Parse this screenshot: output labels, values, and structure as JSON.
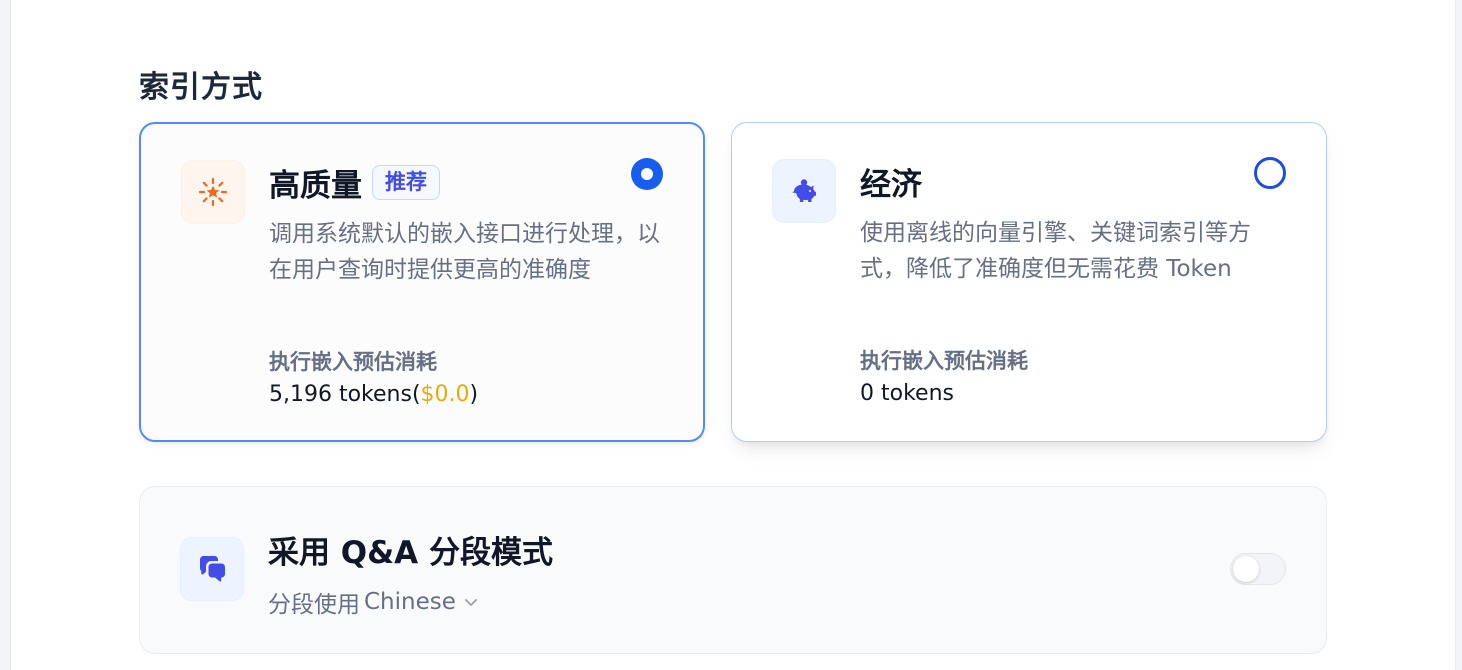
{
  "index_method": {
    "title": "索引方式",
    "options": [
      {
        "title": "高质量",
        "badge": "推荐",
        "description": "调用系统默认的嵌入接口进行处理，以在用户查询时提供更高的准确度",
        "cost_label": "执行嵌入预估消耗",
        "cost_tokens": "5,196 tokens(",
        "cost_price": "$0.0",
        "cost_close": ")",
        "selected": true,
        "icon": "star-icon",
        "accent_color": "#ef6820"
      },
      {
        "title": "经济",
        "description": "使用离线的向量引擎、关键词索引等方式，降低了准确度但无需花费 Token",
        "cost_label": "执行嵌入预估消耗",
        "cost_tokens": "0 tokens",
        "selected": false,
        "icon": "piggy-bank-icon",
        "accent_color": "#444ce7"
      }
    ]
  },
  "qa_mode": {
    "title": "采用 Q&A 分段模式",
    "language_prefix": "分段使用",
    "language": "Chinese",
    "enabled": false,
    "icon": "chat-bubbles-icon"
  },
  "colors": {
    "primary": "#155eef",
    "price": "#eaaa08",
    "badge": "#444ce7"
  }
}
